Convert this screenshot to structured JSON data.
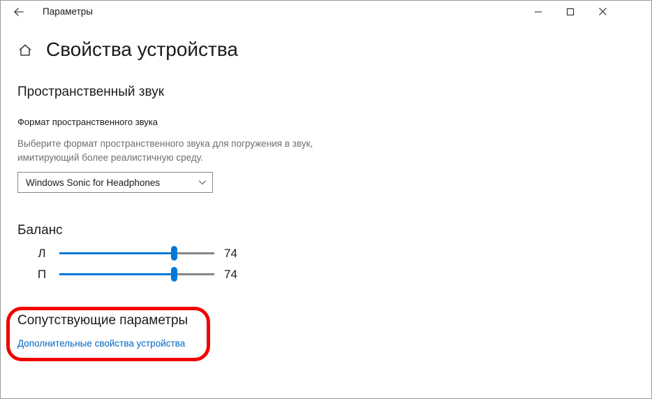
{
  "window": {
    "titlebar": {
      "back_icon": "back-arrow-icon",
      "title": "Параметры",
      "minimize_icon": "minimize-icon",
      "maximize_icon": "maximize-icon",
      "close_icon": "close-icon"
    },
    "header": {
      "home_icon": "home-icon",
      "title": "Свойства устройства"
    }
  },
  "spatial_sound": {
    "heading": "Пространственный звук",
    "format_label": "Формат пространственного звука",
    "description": "Выберите формат пространственного звука для погружения в звук, имитирующий более реалистичную среду.",
    "dropdown": {
      "value": "Windows Sonic for Headphones",
      "chevron_icon": "chevron-down-icon",
      "options": [
        "Windows Sonic for Headphones"
      ]
    }
  },
  "balance": {
    "heading": "Баланс",
    "sliders": [
      {
        "channel": "Л",
        "value": "74",
        "percent": 74
      },
      {
        "channel": "П",
        "value": "74",
        "percent": 74
      }
    ]
  },
  "related_settings": {
    "heading": "Сопутствующие параметры",
    "link": "Дополнительные свойства устройства",
    "highlight_color": "#f20000"
  },
  "colors": {
    "accent": "#0078d7",
    "link": "#0067c0",
    "text": "#1b1b1b",
    "muted_text": "#6e6e6e",
    "border": "#868686",
    "highlight": "#f20000"
  }
}
